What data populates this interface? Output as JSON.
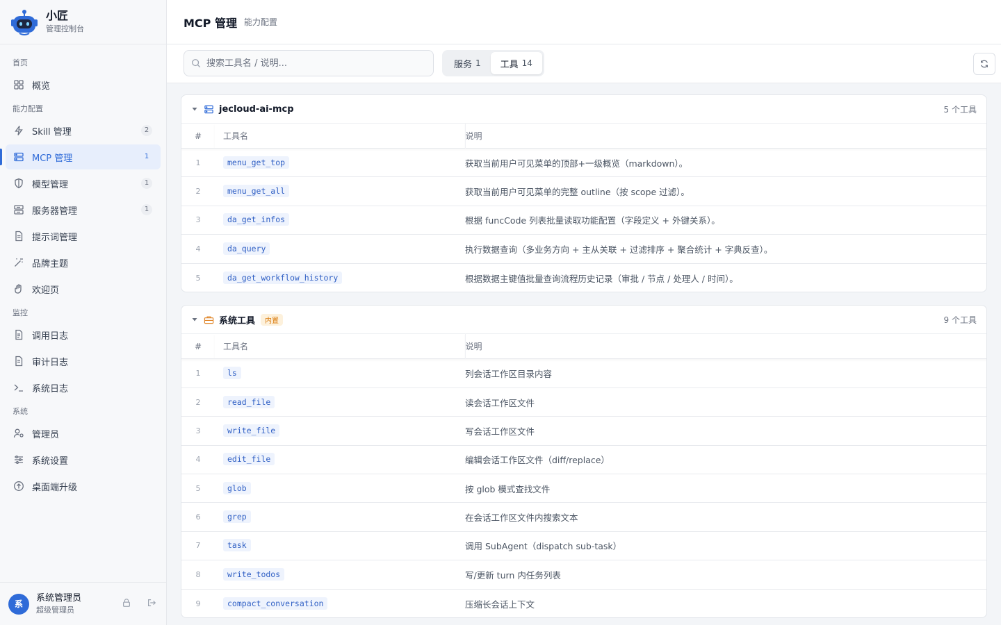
{
  "brand": {
    "name": "小匠",
    "subtitle": "管理控制台"
  },
  "sidebar": {
    "sections": [
      {
        "label": "首页",
        "items": [
          {
            "label": "概览",
            "icon": "grid-icon",
            "badge": ""
          }
        ]
      },
      {
        "label": "能力配置",
        "items": [
          {
            "label": "Skill 管理",
            "icon": "bolt-icon",
            "badge": "2"
          },
          {
            "label": "MCP 管理",
            "icon": "server-icon",
            "badge": "1",
            "active": true
          },
          {
            "label": "模型管理",
            "icon": "shield-icon",
            "badge": "1"
          },
          {
            "label": "服务器管理",
            "icon": "server-stack-icon",
            "badge": "1"
          },
          {
            "label": "提示词管理",
            "icon": "document-icon",
            "badge": ""
          },
          {
            "label": "品牌主题",
            "icon": "wand-icon",
            "badge": ""
          },
          {
            "label": "欢迎页",
            "icon": "hand-wave-icon",
            "badge": ""
          }
        ]
      },
      {
        "label": "监控",
        "items": [
          {
            "label": "调用日志",
            "icon": "log-icon",
            "badge": ""
          },
          {
            "label": "审计日志",
            "icon": "audit-icon",
            "badge": ""
          },
          {
            "label": "系统日志",
            "icon": "terminal-icon",
            "badge": ""
          }
        ]
      },
      {
        "label": "系统",
        "items": [
          {
            "label": "管理员",
            "icon": "user-key-icon",
            "badge": ""
          },
          {
            "label": "系统设置",
            "icon": "sliders-icon",
            "badge": ""
          },
          {
            "label": "桌面端升级",
            "icon": "upgrade-icon",
            "badge": ""
          }
        ]
      }
    ]
  },
  "user": {
    "avatar_text": "系",
    "name": "系统管理员",
    "role": "超级管理员"
  },
  "header": {
    "title": "MCP 管理",
    "breadcrumb": "能力配置"
  },
  "toolbar": {
    "search_placeholder": "搜索工具名 / 说明...",
    "tabs": [
      {
        "label": "服务",
        "count": "1"
      },
      {
        "label": "工具",
        "count": "14",
        "active": true
      }
    ]
  },
  "groups": [
    {
      "name": "jecloud-ai-mcp",
      "tag": "",
      "count_label": "5 个工具",
      "icon": "server-icon",
      "columns": [
        "#",
        "工具名",
        "说明"
      ],
      "rows": [
        {
          "n": "1",
          "tool": "menu_get_top",
          "desc": "获取当前用户可见菜单的顶部+一级概览（markdown）。"
        },
        {
          "n": "2",
          "tool": "menu_get_all",
          "desc": "获取当前用户可见菜单的完整 outline（按 scope 过滤）。"
        },
        {
          "n": "3",
          "tool": "da_get_infos",
          "desc": "根据 funcCode 列表批量读取功能配置（字段定义 + 外键关系）。"
        },
        {
          "n": "4",
          "tool": "da_query",
          "desc": "执行数据查询（多业务方向 + 主从关联 + 过滤排序 + 聚合统计 + 字典反查）。"
        },
        {
          "n": "5",
          "tool": "da_get_workflow_history",
          "desc": "根据数据主键值批量查询流程历史记录（审批 / 节点 / 处理人 / 时间）。"
        }
      ]
    },
    {
      "name": "系统工具",
      "tag": "内置",
      "count_label": "9 个工具",
      "icon": "toolbox-icon",
      "columns": [
        "#",
        "工具名",
        "说明"
      ],
      "rows": [
        {
          "n": "1",
          "tool": "ls",
          "desc": "列会话工作区目录内容"
        },
        {
          "n": "2",
          "tool": "read_file",
          "desc": "读会话工作区文件"
        },
        {
          "n": "3",
          "tool": "write_file",
          "desc": "写会话工作区文件"
        },
        {
          "n": "4",
          "tool": "edit_file",
          "desc": "编辑会话工作区文件（diff/replace）"
        },
        {
          "n": "5",
          "tool": "glob",
          "desc": "按 glob 模式查找文件"
        },
        {
          "n": "6",
          "tool": "grep",
          "desc": "在会话工作区文件内搜索文本"
        },
        {
          "n": "7",
          "tool": "task",
          "desc": "调用 SubAgent（dispatch sub-task）"
        },
        {
          "n": "8",
          "tool": "write_todos",
          "desc": "写/更新 turn 内任务列表"
        },
        {
          "n": "9",
          "tool": "compact_conversation",
          "desc": "压缩长会话上下文"
        }
      ]
    }
  ],
  "colors": {
    "accent": "#2f6bd8",
    "tag_orange": "#d97706"
  }
}
